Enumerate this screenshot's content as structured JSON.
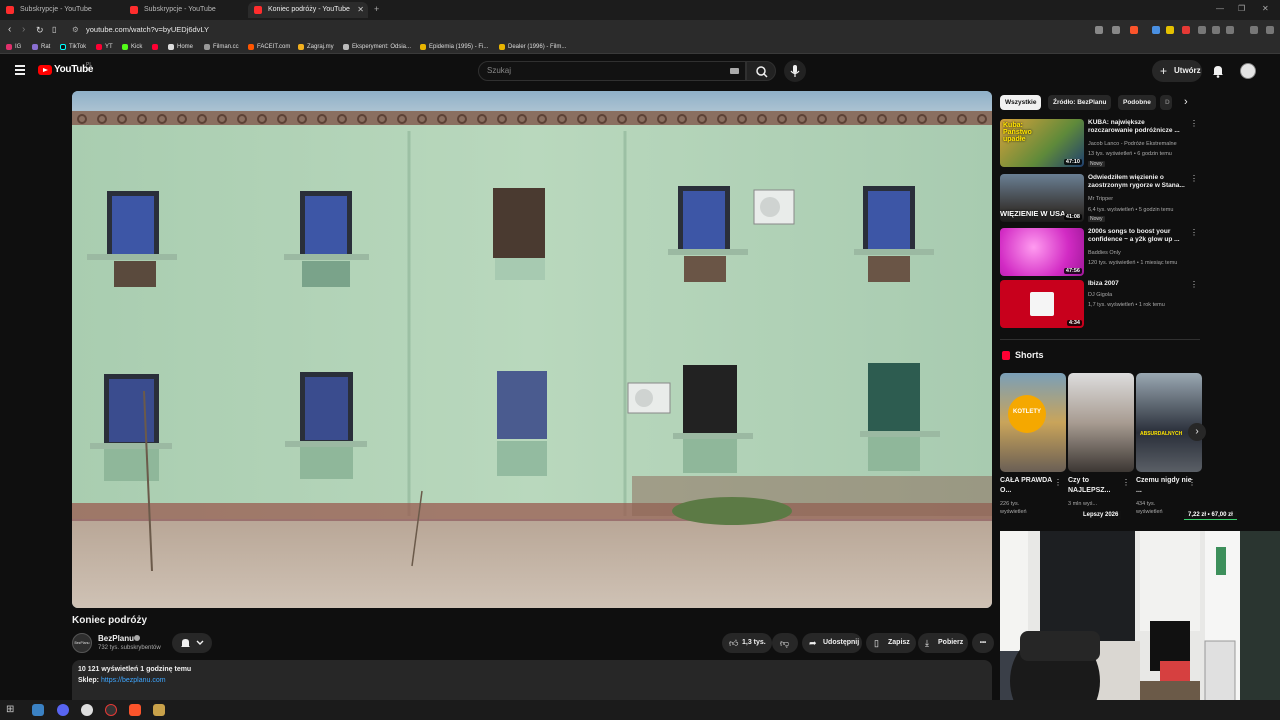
{
  "browser": {
    "tabs": [
      {
        "title": "Subskrypcje - YouTube"
      },
      {
        "title": "Subskrypcje - YouTube"
      },
      {
        "title": "Koniec podróży - YouTube",
        "active": true
      }
    ],
    "new_tab_label": "+",
    "close_tab_label": "✕",
    "window_controls": [
      "—",
      "❐",
      "✕"
    ],
    "url": "youtube.com/watch?v=byUEDj6dvLY",
    "bookmarks": [
      {
        "label": "IG",
        "color": "#e1306c"
      },
      {
        "label": "Rat",
        "color": "#8a6fd1"
      },
      {
        "label": "TikTok",
        "color": "#111111"
      },
      {
        "label": "YT",
        "color": "#ff0033"
      },
      {
        "label": "Kick",
        "color": "#53fc18"
      },
      {
        "label": "",
        "color": "#ff0033"
      },
      {
        "label": "Home",
        "color": "#dddddd"
      },
      {
        "label": "Filman.cc",
        "color": "#999999"
      },
      {
        "label": "FACEIT.com",
        "color": "#ff5500"
      },
      {
        "label": "Zagraj.my",
        "color": "#f2b01e"
      },
      {
        "label": "Eksperyment: Odsia...",
        "color": "#bbbbbb"
      },
      {
        "label": "Epidemia (1995) - Fi...",
        "color": "#e8b400"
      },
      {
        "label": "Dealer (1996) - Film...",
        "color": "#e8b400"
      }
    ]
  },
  "yt_header": {
    "logo_text": "YouTube",
    "country": "PL",
    "search_placeholder": "Szukaj",
    "create_label": "Utwórz",
    "create_plus": "+"
  },
  "video": {
    "title": "Koniec podróży",
    "channel_name": "BezPlanu",
    "channel_avatar_text": "BezPlanu",
    "subscribers": "732 tys. subskrybentów",
    "likes": "1,3 tys.",
    "share_label": "Udostępnij",
    "save_label": "Zapisz",
    "download_label": "Pobierz",
    "more_label": "•••",
    "description_stats": "10 121 wyświetleń  1 godzinę temu",
    "shop_label": "Sklep:",
    "shop_link": "https://bezplanu.com"
  },
  "chips": [
    "Wszystkie",
    "Źródło: BezPlanu",
    "Podobne",
    "D"
  ],
  "recommendations": [
    {
      "title": "KUBA: największe rozczarowanie podróżnicze ...",
      "channel": "Jacob Lanco - Podróże Ekstremalne",
      "meta": "13 tys. wyświetleń • 6 godzin temu",
      "badge": "Nowy",
      "duration": "47:10",
      "thumb_text": "Kuba: Państwo upadłe",
      "verified": false
    },
    {
      "title": "Odwiedziłem więzienie o zaostrzonym rygorze w Stana...",
      "channel": "Mr Tripper",
      "meta": "6,4 tys. wyświetleń • 5 godzin temu",
      "badge": "Nowy",
      "duration": "41:08",
      "thumb_text": "WIĘZIENIE W USA",
      "verified": true
    },
    {
      "title": "2000s songs to boost your confidence ~ a y2k glow up ...",
      "channel": "Baddies Only",
      "meta": "120 tys. wyświetleń • 1 miesiąc temu",
      "badge": "",
      "duration": "47:56",
      "thumb_text": "",
      "verified": false
    },
    {
      "title": "Ibiza 2007",
      "channel": "DJ Gigola",
      "meta": "1,7 tys. wyświetleń • 1 rok temu",
      "badge": "",
      "duration": "4:34",
      "thumb_text": "",
      "verified": true
    }
  ],
  "shorts": {
    "heading": "Shorts",
    "items": [
      {
        "title": "CAŁA PRAWDA O...",
        "views": "226 tys. wyświetleń",
        "thumb_text": "KOTLETY"
      },
      {
        "title": "Czy to NAJLEPSZ...",
        "views": "3 mln wyś...",
        "thumb_text": ""
      },
      {
        "title": "Czemu nigdy nie ...",
        "views": "434 tys. wyświetleń",
        "thumb_text": "ABSURDALNYCH"
      }
    ],
    "overlay_badge": "Lepszy 2026",
    "price_overlay": "7,22 zł  •  67,00 zł"
  },
  "icons": {
    "menu": "hamburger-icon",
    "search": "search-icon",
    "mic": "mic-icon",
    "bell": "bell-icon",
    "like": "thumbs-up-icon",
    "dislike": "thumbs-down-icon",
    "share": "share-icon",
    "save": "bookmark-icon",
    "download": "download-icon"
  },
  "colors": {
    "yt_red": "#ff0000",
    "link_blue": "#3ea6ff",
    "bg": "#0f0f0f",
    "surface": "#272727"
  }
}
